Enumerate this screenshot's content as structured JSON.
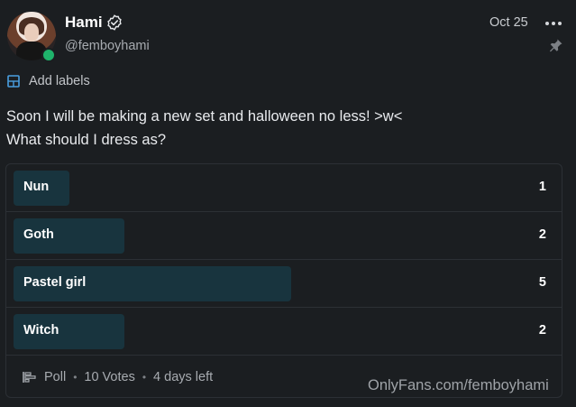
{
  "post": {
    "author": {
      "name": "Hami",
      "handle": "@femboyhami",
      "online": true
    },
    "date": "Oct 25",
    "labels_text": "Add labels",
    "text_lines": [
      "Soon I will be making a new set and halloween no less! >w<",
      "What should I dress as?"
    ]
  },
  "poll": {
    "total_max": 5,
    "options": [
      {
        "label": "Nun",
        "votes": "1",
        "share": 0.2
      },
      {
        "label": "Goth",
        "votes": "2",
        "share": 0.4
      },
      {
        "label": "Pastel girl",
        "votes": "5",
        "share": 1.0
      },
      {
        "label": "Witch",
        "votes": "2",
        "share": 0.4
      }
    ],
    "footer": {
      "type_label": "Poll",
      "votes_label": "10 Votes",
      "time_left": "4 days left"
    }
  },
  "watermark": "OnlyFans.com/femboyhami",
  "icons": {
    "verified": "verified-badge-icon",
    "more": "more-horizontal-icon",
    "pin": "pin-icon",
    "labels": "label-icon",
    "poll": "poll-icon"
  },
  "colors": {
    "background": "#1b1e21",
    "poll_bar": "#18343e",
    "online": "#1fb36b"
  }
}
